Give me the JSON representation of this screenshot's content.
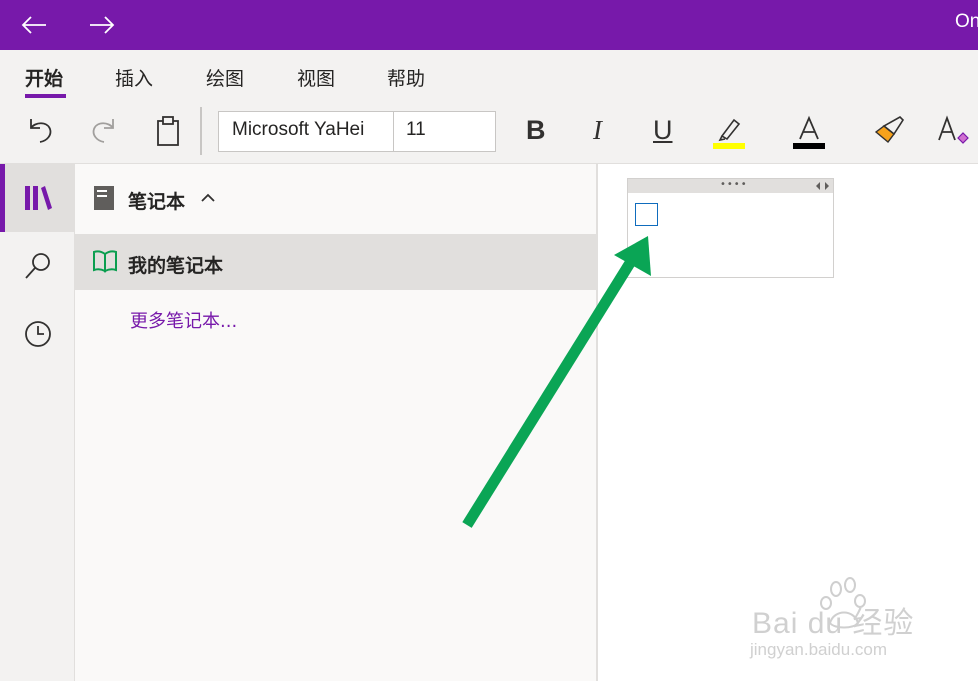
{
  "titlebar": {
    "title": "On",
    "accent_color": "#7719aa",
    "back_icon": "arrow-left-icon",
    "forward_icon": "arrow-right-icon"
  },
  "ribbon": {
    "tabs": [
      {
        "label": "开始",
        "active": true
      },
      {
        "label": "插入",
        "active": false
      },
      {
        "label": "绘图",
        "active": false
      },
      {
        "label": "视图",
        "active": false
      },
      {
        "label": "帮助",
        "active": false
      }
    ],
    "toolbar": {
      "font_name": "Microsoft YaHei",
      "font_size": "11",
      "bold_label": "B",
      "italic_label": "I",
      "underline_label": "U",
      "font_color_label": "A",
      "highlight_color": "#ffff00",
      "font_color": "#000000",
      "icons": [
        "undo-icon",
        "redo-icon",
        "clipboard-icon",
        "highlighter-icon",
        "font-color-icon",
        "format-painter-icon",
        "clear-formatting-icon"
      ]
    }
  },
  "rail": {
    "items": [
      "notebooks-icon",
      "search-icon",
      "recent-icon"
    ]
  },
  "notebooks": {
    "header": "笔记本",
    "items": [
      {
        "label": "我的笔记本",
        "selected": true
      }
    ],
    "more_link": "更多笔记本..."
  },
  "canvas": {
    "note_grip": "••••",
    "checkbox_checked": false,
    "arrow_color": "#0aa555"
  },
  "watermark": {
    "line1": "Bai du 经验",
    "line2": "jingyan.baidu.com"
  }
}
